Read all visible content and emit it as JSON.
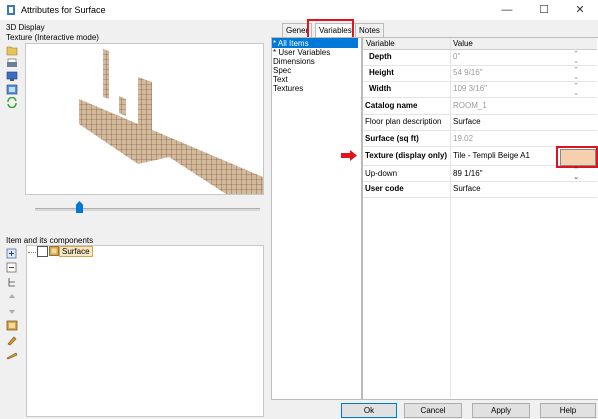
{
  "window": {
    "title": "Attributes for Surface",
    "controls": {
      "minimize": "—",
      "maximize": "☐",
      "close": "✕"
    }
  },
  "left": {
    "display_label": "3D Display",
    "texture_mode_label": "Texture (Interactive mode)",
    "components_label": "Item and its components",
    "tree_item": "Surface"
  },
  "tabs": [
    {
      "label": "Gener"
    },
    {
      "label": "Variables"
    },
    {
      "label": "Notes"
    }
  ],
  "categories": [
    "* All Items",
    "* User Variables",
    "Dimensions",
    "Spec",
    "Text",
    "Textures"
  ],
  "grid": {
    "headers": {
      "variable": "Variable",
      "value": "Value"
    },
    "rows": [
      {
        "variable": "Depth",
        "value": "0\""
      },
      {
        "variable": "Height",
        "value": "54 9/16\""
      },
      {
        "variable": "Width",
        "value": "109 3/16\""
      },
      {
        "variable": "Catalog name",
        "value": "ROOM_1"
      },
      {
        "variable": "Floor plan description",
        "value": "Surface"
      },
      {
        "variable": "Surface (sq ft)",
        "value": "19.02"
      },
      {
        "variable": "Texture (display only)",
        "value": "Tile - Templi Beige A1"
      },
      {
        "variable": "Up-down",
        "value": "89 1/16\""
      },
      {
        "variable": "User code",
        "value": "Surface"
      }
    ]
  },
  "buttons": {
    "ok": "Ok",
    "cancel": "Cancel",
    "apply": "Apply",
    "help": "Help"
  },
  "colors": {
    "accent": "#0078d7",
    "highlight": "#e0141e",
    "texture_swatch": "#f5cfae"
  }
}
